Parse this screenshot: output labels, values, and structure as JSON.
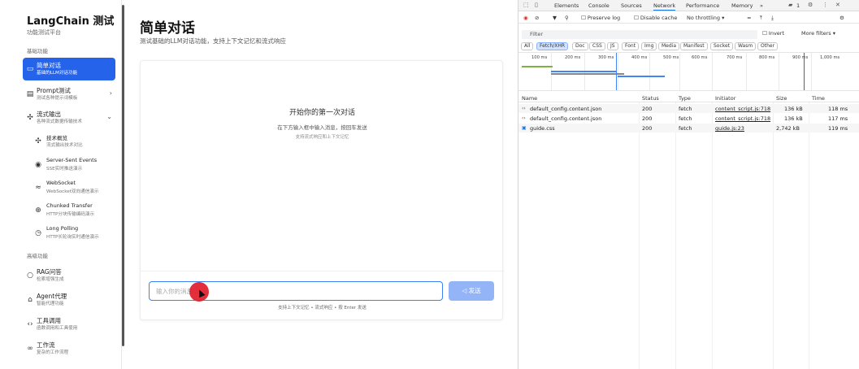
{
  "sidebar": {
    "brand": "LangChain 测试",
    "brand_sub": "功能测试平台",
    "section_basic": "基础功能",
    "section_advanced": "高级功能",
    "items": [
      {
        "title": "简单对话",
        "desc": "基础的LLM对话功能",
        "icon": "chat-icon",
        "active": true
      },
      {
        "title": "Prompt测试",
        "desc": "测试各种提示词模板",
        "icon": "document-icon",
        "chevron": "›"
      },
      {
        "title": "流式输出",
        "desc": "各种流式数据传输技术",
        "icon": "stream-icon",
        "chevron": "⌄"
      },
      {
        "title": "技术概览",
        "desc": "流式输出技术对比",
        "icon": "overview-icon"
      },
      {
        "title": "Server-Sent Events",
        "desc": "SSE实时推送演示",
        "icon": "broadcast-icon"
      },
      {
        "title": "WebSocket",
        "desc": "WebSocket双向通信演示",
        "icon": "wifi-icon"
      },
      {
        "title": "Chunked Transfer",
        "desc": "HTTP分块传输编码演示",
        "icon": "globe-icon"
      },
      {
        "title": "Long Polling",
        "desc": "HTTP长轮询实时通信演示",
        "icon": "clock-icon"
      },
      {
        "title": "RAG问答",
        "desc": "检索增强生成",
        "icon": "search-icon"
      },
      {
        "title": "Agent代理",
        "desc": "智能代理功能",
        "icon": "robot-icon"
      },
      {
        "title": "工具调用",
        "desc": "函数调用和工具使用",
        "icon": "code-icon"
      },
      {
        "title": "工作流",
        "desc": "复杂的工作流程",
        "icon": "workflow-icon"
      }
    ]
  },
  "main": {
    "title": "简单对话",
    "subtitle": "测试基础的LLM对话功能，支持上下文记忆和流式响应",
    "empty_title": "开始你的第一次对话",
    "empty_sub": "在下方输入框中输入消息，按回车发送",
    "empty_sub2": "支持流式响应和上下文记忆",
    "input_placeholder": "输入你的消息...",
    "send_label": "发送",
    "input_hint": "支持上下文记忆 • 流式响应 • 按 Enter 发送"
  },
  "devtools": {
    "tabs": [
      "Elements",
      "Console",
      "Sources",
      "Network",
      "Performance",
      "Memory",
      "»"
    ],
    "active_tab": "Network",
    "issues_count": "1",
    "toolbar": {
      "preserve_log": "Preserve log",
      "disable_cache": "Disable cache",
      "throttling": "No throttling"
    },
    "filter_placeholder": "Filter",
    "invert_label": "Invert",
    "more_filters": "More filters ▾",
    "types": [
      "All",
      "Fetch/XHR",
      "Doc",
      "CSS",
      "JS",
      "Font",
      "Img",
      "Media",
      "Manifest",
      "Socket",
      "Wasm",
      "Other"
    ],
    "active_type": "Fetch/XHR",
    "timeline_ticks": [
      "100 ms",
      "200 ms",
      "300 ms",
      "400 ms",
      "500 ms",
      "600 ms",
      "700 ms",
      "800 ms",
      "900 ms",
      "1,000 ms"
    ],
    "columns": [
      "Name",
      "Status",
      "Type",
      "Initiator",
      "Size",
      "Time"
    ],
    "rows": [
      {
        "name": "default_config.content.json",
        "status": "200",
        "type": "fetch",
        "initiator": "content_script.js:718",
        "size": "136 kB",
        "time": "118 ms",
        "icon": "json-icon"
      },
      {
        "name": "default_config.content.json",
        "status": "200",
        "type": "fetch",
        "initiator": "content_script.js:718",
        "size": "136 kB",
        "time": "117 ms",
        "icon": "json-icon"
      },
      {
        "name": "guide.css",
        "status": "200",
        "type": "fetch",
        "initiator": "guide.js:23",
        "size": "2,742 kB",
        "time": "119 ms",
        "icon": "css-file-icon"
      }
    ],
    "colors": {
      "accent": "#1a73e8",
      "record": "#d93025"
    }
  },
  "colors": {
    "primary": "#2563eb",
    "send_disabled": "#93b4f7",
    "cursor": "#e11d2a"
  }
}
